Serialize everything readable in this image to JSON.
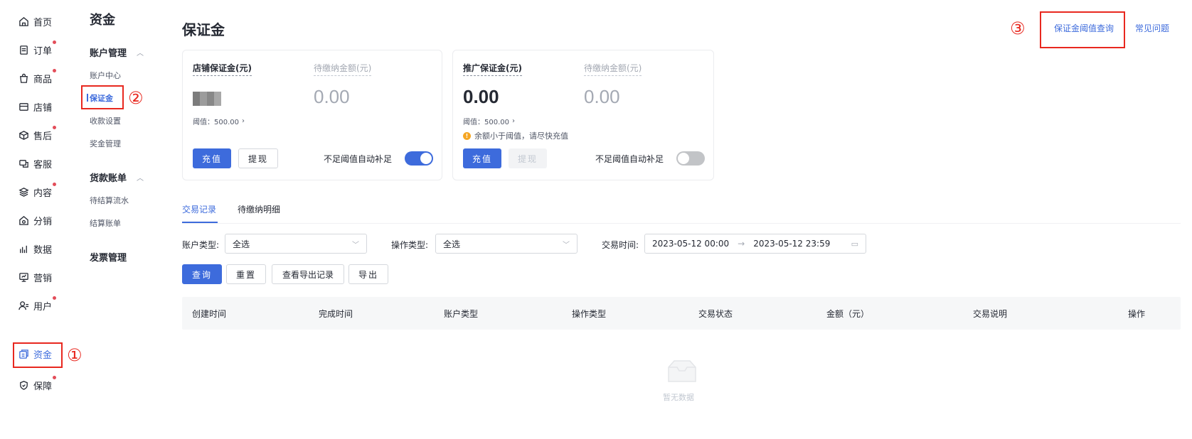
{
  "nav": {
    "items": [
      {
        "label": "首页",
        "icon": "home-icon",
        "badge": false
      },
      {
        "label": "订单",
        "icon": "order-icon",
        "badge": true
      },
      {
        "label": "商品",
        "icon": "product-bag-icon",
        "badge": true
      },
      {
        "label": "店铺",
        "icon": "shop-icon",
        "badge": false
      },
      {
        "label": "售后",
        "icon": "after-sale-box-icon",
        "badge": true
      },
      {
        "label": "客服",
        "icon": "chat-icon",
        "badge": false
      },
      {
        "label": "内容",
        "icon": "layers-icon",
        "badge": true
      },
      {
        "label": "分销",
        "icon": "distribution-icon",
        "badge": false
      },
      {
        "label": "数据",
        "icon": "bar-chart-icon",
        "badge": false
      },
      {
        "label": "营销",
        "icon": "marketing-icon",
        "badge": false
      },
      {
        "label": "用户",
        "icon": "user-icon",
        "badge": true
      },
      {
        "label": "资金",
        "icon": "fund-icon",
        "badge": false,
        "active": true
      },
      {
        "label": "保障",
        "icon": "shield-icon",
        "badge": true
      }
    ]
  },
  "subnav": {
    "title": "资金",
    "groups": [
      {
        "label": "账户管理",
        "items": [
          "账户中心",
          "保证金",
          "收款设置",
          "奖金管理"
        ]
      },
      {
        "label": "货款账单",
        "items": [
          "待结算流水",
          "结算账单"
        ]
      },
      {
        "label": "发票管理",
        "items": []
      }
    ]
  },
  "annotations": {
    "n1": "①",
    "n2": "②",
    "n3": "③"
  },
  "page": {
    "title": "保证金",
    "link_threshold": "保证金阈值查询",
    "link_faq": "常见问题"
  },
  "cards": {
    "shop": {
      "label": "店铺保证金(元)",
      "pending_label": "待缴纳金额(元)",
      "pending_value": "0.00",
      "threshold": "阈值：500.00",
      "recharge": "充值",
      "withdraw": "提现",
      "auto_fill": "不足阈值自动补足",
      "toggle_on": true
    },
    "promo": {
      "label": "推广保证金(元)",
      "balance": "0.00",
      "pending_label": "待缴纳金额(元)",
      "pending_value": "0.00",
      "threshold": "阈值：500.00",
      "warning": "余额小于阈值，请尽快充值",
      "recharge": "充值",
      "withdraw": "提现",
      "auto_fill": "不足阈值自动补足",
      "toggle_on": false
    }
  },
  "tabs": [
    "交易记录",
    "待缴纳明细"
  ],
  "filters": {
    "account_type_label": "账户类型:",
    "account_type_value": "全选",
    "op_type_label": "操作类型:",
    "op_type_value": "全选",
    "time_label": "交易时间:",
    "time_start": "2023-05-12 00:00",
    "time_end": "2023-05-12 23:59"
  },
  "actions": {
    "query": "查询",
    "reset": "重置",
    "export_log": "查看导出记录",
    "export": "导出"
  },
  "table": {
    "columns": [
      "创建时间",
      "完成时间",
      "账户类型",
      "操作类型",
      "交易状态",
      "金额（元）",
      "交易说明",
      "操作"
    ],
    "empty": "暂无数据"
  },
  "colors": {
    "accent": "#3d6bdc",
    "annotation": "#e8281f",
    "badge": "#e34d59"
  }
}
